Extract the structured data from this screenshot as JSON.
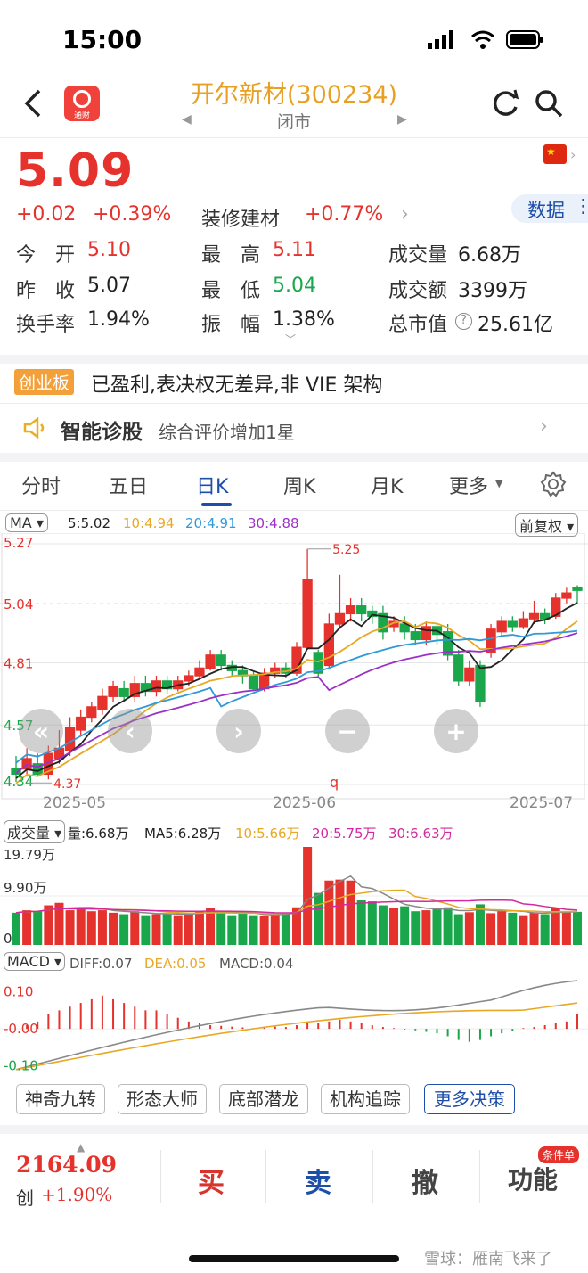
{
  "status": {
    "time": "15:00"
  },
  "header": {
    "title": "开尔新材(300234)",
    "subtitle": "闭市",
    "logo_text": "通财"
  },
  "quote": {
    "price": "5.09",
    "change": "+0.02",
    "change_pct": "+0.39%",
    "sector": "装修建材",
    "sector_pct": "+0.77%",
    "data_button": "数据"
  },
  "stats": [
    {
      "label": "今　开",
      "value": "5.10"
    },
    {
      "label": "最　高",
      "value": "5.11"
    },
    {
      "label": "成交量",
      "value": "6.68万"
    },
    {
      "label": "昨　收",
      "value": "5.07"
    },
    {
      "label": "最　低",
      "value": "5.04"
    },
    {
      "label": "成交额",
      "value": "3399万"
    },
    {
      "label": "换手率",
      "value": "1.94%"
    },
    {
      "label": "振　幅",
      "value": "1.38%"
    },
    {
      "label": "总市值",
      "value": "25.61亿"
    }
  ],
  "board": {
    "tag": "创业板",
    "text": "已盈利,表决权无差异,非 VIE 架构"
  },
  "diagnosis": {
    "title": "智能诊股",
    "text": "综合评价增加1星"
  },
  "tabs": [
    "分时",
    "五日",
    "日K",
    "周K",
    "月K",
    "更多"
  ],
  "ma": {
    "selector": "MA",
    "ma5": "5:5.02",
    "ma10": "10:4.94",
    "ma20": "20:4.91",
    "ma30": "30:4.88",
    "adjust": "前复权"
  },
  "kchart": {
    "y_labels": [
      "5.27",
      "5.04",
      "4.81",
      "4.57",
      "4.34"
    ],
    "high_label": "5.25",
    "low_label": "4.37",
    "q_label": "q",
    "x_labels": [
      "2025-05",
      "2025-06",
      "2025-07"
    ]
  },
  "volume": {
    "selector": "成交量",
    "vol": "量:6.68万",
    "ma5": "MA5:6.28万",
    "ma10": "10:5.66万",
    "ma20": "20:5.75万",
    "ma30": "30:6.63万",
    "y_labels": [
      "19.79万",
      "9.90万",
      "0"
    ]
  },
  "macd": {
    "selector": "MACD",
    "diff": "DIFF:0.07",
    "dea": "DEA:0.05",
    "macd": "MACD:0.04",
    "y_labels": [
      "0.10",
      "-0.00",
      "-0.10"
    ]
  },
  "strategies": [
    "神奇九转",
    "形态大师",
    "底部潜龙",
    "机构追踪",
    "更多决策"
  ],
  "bottom": {
    "index_value": "2164.09",
    "index_name": "创",
    "index_pct": "+1.90%",
    "buy": "买",
    "sell": "卖",
    "cancel": "撤",
    "func": "功能",
    "badge": "条件单",
    "watermark": "雪球：雁南飞来了"
  },
  "colors": {
    "up": "#e5322d",
    "down": "#1aa64a",
    "ma5": "#222222",
    "ma10": "#e8a824",
    "ma20": "#2f9ad8",
    "ma30": "#9b30c8"
  }
}
